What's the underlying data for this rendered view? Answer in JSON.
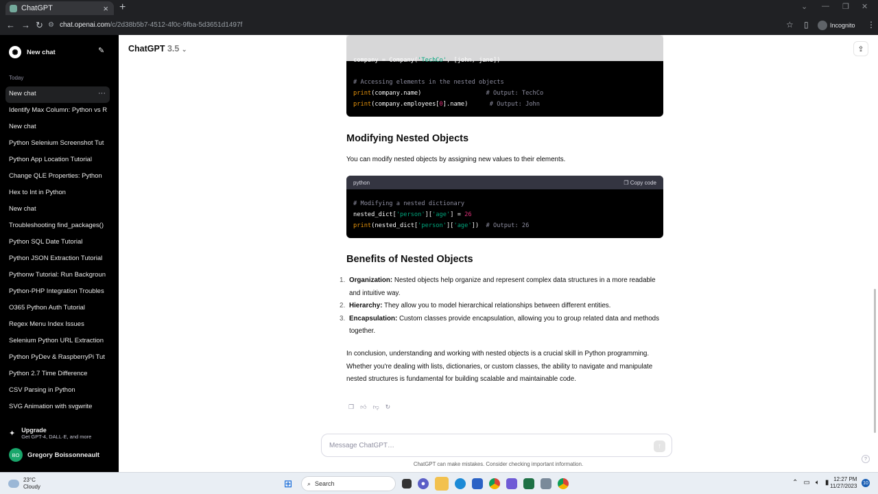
{
  "browser": {
    "tab_title": "ChatGPT",
    "url_host": "chat.openai.com",
    "url_path": "/c/2d38b5b7-4512-4f0c-9fba-5d3651d1497f",
    "incognito_label": "Incognito"
  },
  "sidebar": {
    "new_chat_label": "New chat",
    "section_label": "Today",
    "items": [
      {
        "label": "New chat",
        "active": true
      },
      {
        "label": "Identify Max Column: Python vs R"
      },
      {
        "label": "New chat"
      },
      {
        "label": "Python Selenium Screenshot Tut"
      },
      {
        "label": "Python App Location Tutorial"
      },
      {
        "label": "Change QLE Properties: Python"
      },
      {
        "label": "Hex to Int in Python"
      },
      {
        "label": "New chat"
      },
      {
        "label": "Troubleshooting find_packages()"
      },
      {
        "label": "Python SQL Date Tutorial"
      },
      {
        "label": "Python JSON Extraction Tutorial"
      },
      {
        "label": "Pythonw Tutorial: Run Backgroun"
      },
      {
        "label": "Python-PHP Integration Troubles"
      },
      {
        "label": "O365 Python Auth Tutorial"
      },
      {
        "label": "Regex Menu Index Issues"
      },
      {
        "label": "Selenium Python URL Extraction"
      },
      {
        "label": "Python PyDev & RaspberryPi Tut"
      },
      {
        "label": "Python 2.7 Time Difference"
      },
      {
        "label": "CSV Parsing in Python"
      },
      {
        "label": "SVG Animation with svgwrite"
      }
    ],
    "upgrade_title": "Upgrade",
    "upgrade_sub": "Get GPT-4, DALL·E, and more",
    "user_initials": "BO",
    "user_name": "Gregory Boissonneault"
  },
  "header": {
    "model_name": "ChatGPT",
    "model_version": "3.5"
  },
  "code1": {
    "line1_a": "company = Company(",
    "line1_b": "'TechCo'",
    "line1_c": ", [john, jane])",
    "line2": "# Accessing elements in the nested objects",
    "line3_a": "print",
    "line3_b": "(company.name)                  ",
    "line3_c": "# Output: TechCo",
    "line4_a": "print",
    "line4_b": "(company.employees[",
    "line4_n": "0",
    "line4_c": "].name)      ",
    "line4_d": "# Output: John"
  },
  "section1": {
    "heading": "Modifying Nested Objects",
    "text": "You can modify nested objects by assigning new values to their elements."
  },
  "code2": {
    "lang": "python",
    "copy_label": "Copy code",
    "line1": "# Modifying a nested dictionary",
    "line2_a": "nested_dict[",
    "line2_b": "'person'",
    "line2_c": "][",
    "line2_d": "'age'",
    "line2_e": "] = ",
    "line2_f": "26",
    "line3_a": "print",
    "line3_b": "(nested_dict[",
    "line3_c": "'person'",
    "line3_d": "][",
    "line3_e": "'age'",
    "line3_f": "])  ",
    "line3_g": "# Output: 26"
  },
  "section2": {
    "heading": "Benefits of Nested Objects",
    "items": [
      {
        "num": "1.",
        "term": "Organization:",
        "text": " Nested objects help organize and represent complex data structures in a more readable and intuitive way."
      },
      {
        "num": "2.",
        "term": "Hierarchy:",
        "text": " They allow you to model hierarchical relationships between different entities."
      },
      {
        "num": "3.",
        "term": "Encapsulation:",
        "text": " Custom classes provide encapsulation, allowing you to group related data and methods together."
      }
    ],
    "conclusion": "In conclusion, understanding and working with nested objects is a crucial skill in Python programming. Whether you're dealing with lists, dictionaries, or custom classes, the ability to navigate and manipulate nested structures is fundamental for building scalable and maintainable code."
  },
  "composer": {
    "placeholder": "Message ChatGPT…",
    "disclaimer": "ChatGPT can make mistakes. Consider checking important information."
  },
  "taskbar": {
    "temp": "23°C",
    "condition": "Cloudy",
    "search_label": "Search",
    "time": "12:27 PM",
    "date": "11/27/2023",
    "notifications": "10"
  }
}
